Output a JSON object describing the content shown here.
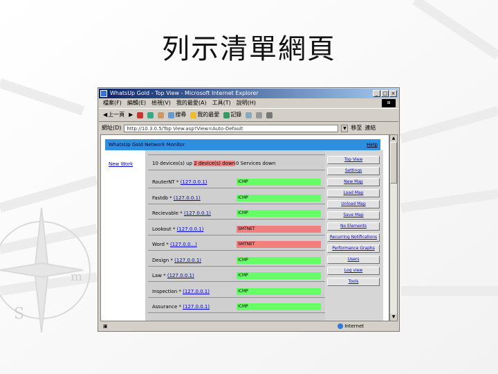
{
  "slide": {
    "title": "列示清單網頁"
  },
  "browser": {
    "window_title": "WhatsUp Gold - Top View - Microsoft Internet Explorer",
    "menu": [
      "檔案(F)",
      "編輯(E)",
      "檢視(V)",
      "我的最愛(A)",
      "工具(T)",
      "說明(H)"
    ],
    "toolbar": {
      "back": "上一頁",
      "search": "搜尋",
      "favorites": "我的最愛",
      "history": "記錄"
    },
    "address_label": "網址(D)",
    "address_value": "http://10.3.0.5/Top View.asp?View=Auto-Default",
    "go_label": "移至",
    "links_label": "連結",
    "status_zone": "Internet"
  },
  "page": {
    "header_title": "WhatsUp Gold Network Monitor",
    "help_link": "Help",
    "new_work_link": "New Work",
    "column_headers": {
      "devices_down_prefix": "10 devices(s) up",
      "devices_down_highlight": "2 device(s) down",
      "services": "0 Services down"
    },
    "devices": [
      {
        "name": "RouterNT *",
        "ip": "(127.0.0.1)",
        "status": "ICMP"
      },
      {
        "name": "Fastdb *",
        "ip": "(127.0.0.1)",
        "status": "ICMP"
      },
      {
        "name": "Recievable *",
        "ip": "(127.0.0.1)",
        "status": "ICMP"
      },
      {
        "name": "Lookout *",
        "ip": "(127.0.0.1)",
        "status": "SMTNET"
      },
      {
        "name": "Word *",
        "ip": "(127.0.0...)",
        "status": "SMTNET"
      },
      {
        "name": "Design *",
        "ip": "(127.0.0.1)",
        "status": "ICMP"
      },
      {
        "name": "Law *",
        "ip": "(127.0.0.1)",
        "status": "ICMP"
      },
      {
        "name": "Inspection *",
        "ip": "(127.0.0.1)",
        "status": "ICMP"
      },
      {
        "name": "Assurance *",
        "ip": "(127.0.0.1)",
        "status": "ICMP"
      }
    ],
    "status_colors": {
      "up": "#66ff66",
      "down": "#f08080"
    },
    "side_menu": [
      "Top View",
      "Settings",
      "New Map",
      "Load Map",
      "Unload Map",
      "Save Map",
      "No Elements",
      "Recurring Notifications",
      "Performance Graphs",
      "Users",
      "Log view",
      "Tools"
    ]
  }
}
